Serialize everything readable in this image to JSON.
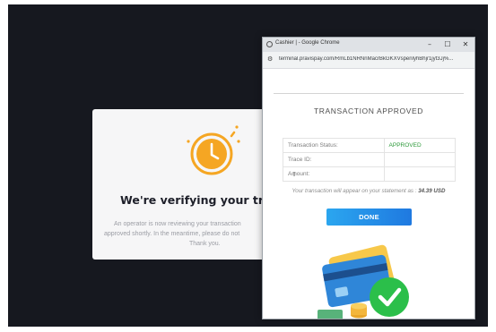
{
  "verify": {
    "title": "We're verifying your transa",
    "body_lines": [
      "An operator is now reviewing your transaction",
      "approved shortly. In the meantime, please do not",
      "Thank you."
    ]
  },
  "popup": {
    "window_title": "Cashier | - Google Chrome",
    "url": "terminal.pravispay.com/RmLb1NRNnMacrBkGKXVspenlyhBhjr1jyt3Jj%...",
    "controls": {
      "minimize": "–",
      "maximize": "☐",
      "close": "✕"
    },
    "heading": "TRANSACTION APPROVED",
    "rows": [
      {
        "label": "Transaction Status:",
        "value": "APPROVED"
      },
      {
        "label": "Trace ID:",
        "value": ""
      },
      {
        "label": "Amount:",
        "value": ""
      }
    ],
    "note_prefix": "Your transaction will appear on your statement as :",
    "note_amount": "34.39 USD",
    "done_label": "DONE"
  },
  "colors": {
    "backdrop": "#16181f",
    "accent_orange": "#f5a623",
    "approved_green": "#2d9a3a",
    "button_blue": "#1f79e0",
    "check_green": "#2bbf4a"
  },
  "icons": [
    "clock-icon",
    "chrome-favicon-icon",
    "site-info-icon",
    "credit-card-icon",
    "checkmark-circle-icon",
    "coin-stack-icon"
  ]
}
